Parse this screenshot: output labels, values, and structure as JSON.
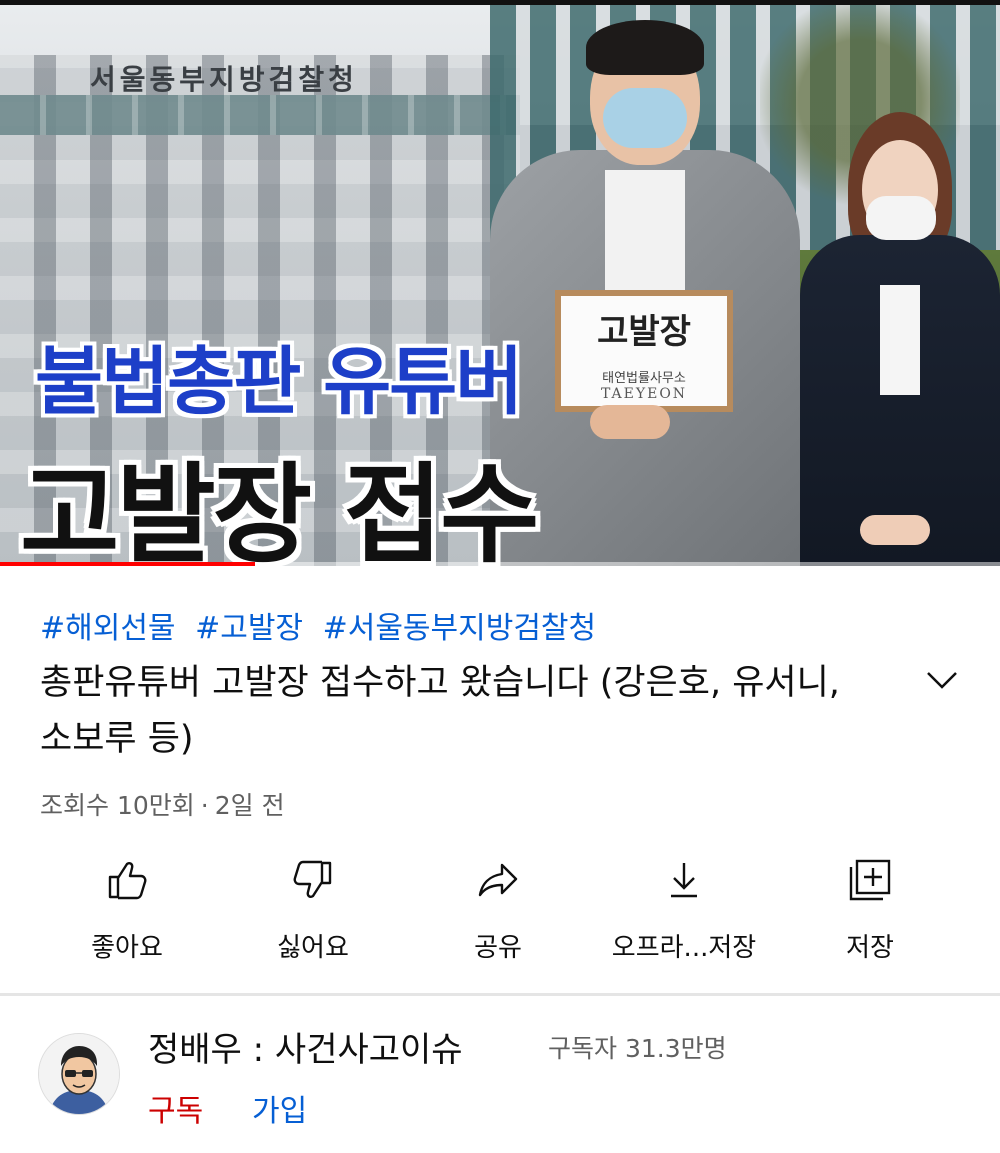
{
  "video": {
    "thumbnail_sign_text": "서울동부지방검찰청",
    "overlay_line1": "불법총판 유튜버",
    "overlay_line2": "고발장 접수",
    "board_title": "고발장",
    "board_firm": "태연법률사무소",
    "board_firm_en": "TAEYEON",
    "progress_fraction": 0.255
  },
  "hashtags": [
    "#해외선물",
    "#고발장",
    "#서울동부지방검찰청"
  ],
  "title": "총판유튜버 고발장 접수하고 왔습니다 (강은호, 유서니, 소보루 등)",
  "meta": {
    "views": "조회수 10만회",
    "separator": "·",
    "age": "2일 전"
  },
  "actions": [
    {
      "icon": "thumbs-up-icon",
      "label": "좋아요"
    },
    {
      "icon": "thumbs-down-icon",
      "label": "싫어요"
    },
    {
      "icon": "share-icon",
      "label": "공유"
    },
    {
      "icon": "download-icon",
      "label": "오프라...저장"
    },
    {
      "icon": "add-to-playlist-icon",
      "label": "저장"
    }
  ],
  "channel": {
    "name": "정배우 : 사건사고이슈",
    "subscribers": "구독자 31.3만명",
    "subscribe_label": "구독",
    "join_label": "가입"
  },
  "colors": {
    "link_blue": "#065fd4",
    "subscribe_red": "#cc0000",
    "progress_red": "#ff0000",
    "overlay_blue": "#1d3fc8"
  }
}
